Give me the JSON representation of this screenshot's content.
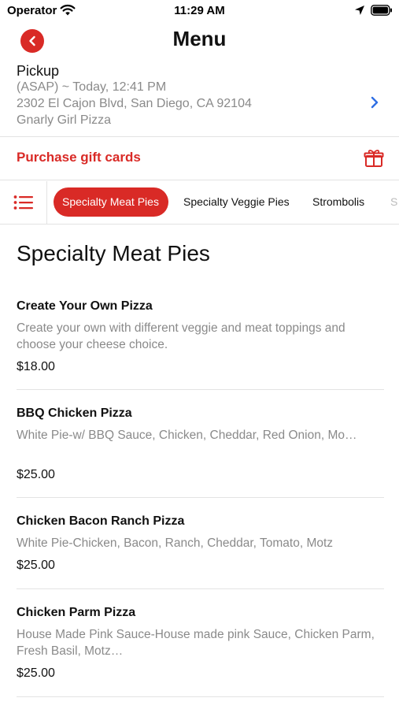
{
  "status_bar": {
    "carrier": "Operator",
    "time": "11:29 AM"
  },
  "nav": {
    "title": "Menu",
    "back_icon": "chevron-left-icon"
  },
  "pickup": {
    "title": "Pickup",
    "time": "(ASAP) ~ Today, 12:41 PM",
    "address": "2302 El Cajon Blvd, San Diego, CA 92104",
    "store": "Gnarly Girl Pizza"
  },
  "gift": {
    "label": "Purchase gift cards",
    "icon": "gift-icon"
  },
  "categories": {
    "menu_icon": "list-icon",
    "tabs": [
      {
        "label": "Specialty Meat Pies",
        "active": true
      },
      {
        "label": "Specialty Veggie Pies",
        "active": false
      },
      {
        "label": "Strombolis",
        "active": false
      },
      {
        "label": "S",
        "active": false
      }
    ]
  },
  "section": {
    "title": "Specialty Meat Pies"
  },
  "items": [
    {
      "name": "Create Your Own Pizza",
      "description": "Create your own with different veggie and meat toppings and choose your cheese choice.",
      "price": "$18.00"
    },
    {
      "name": "BBQ Chicken Pizza",
      "description": "White Pie-w/ BBQ Sauce, Chicken, Cheddar, Red Onion, Mo…",
      "price": "$25.00"
    },
    {
      "name": "Chicken Bacon Ranch Pizza",
      "description": "White Pie-Chicken, Bacon, Ranch, Cheddar, Tomato, Motz",
      "price": "$25.00"
    },
    {
      "name": "Chicken Parm Pizza",
      "description": "House Made Pink Sauce-House made pink Sauce, Chicken Parm, Fresh Basil, Motz…",
      "price": "$25.00"
    }
  ],
  "colors": {
    "accent": "#d92a26",
    "secondary_text": "#8a8a8a",
    "link_chevron": "#2f6fe4"
  }
}
